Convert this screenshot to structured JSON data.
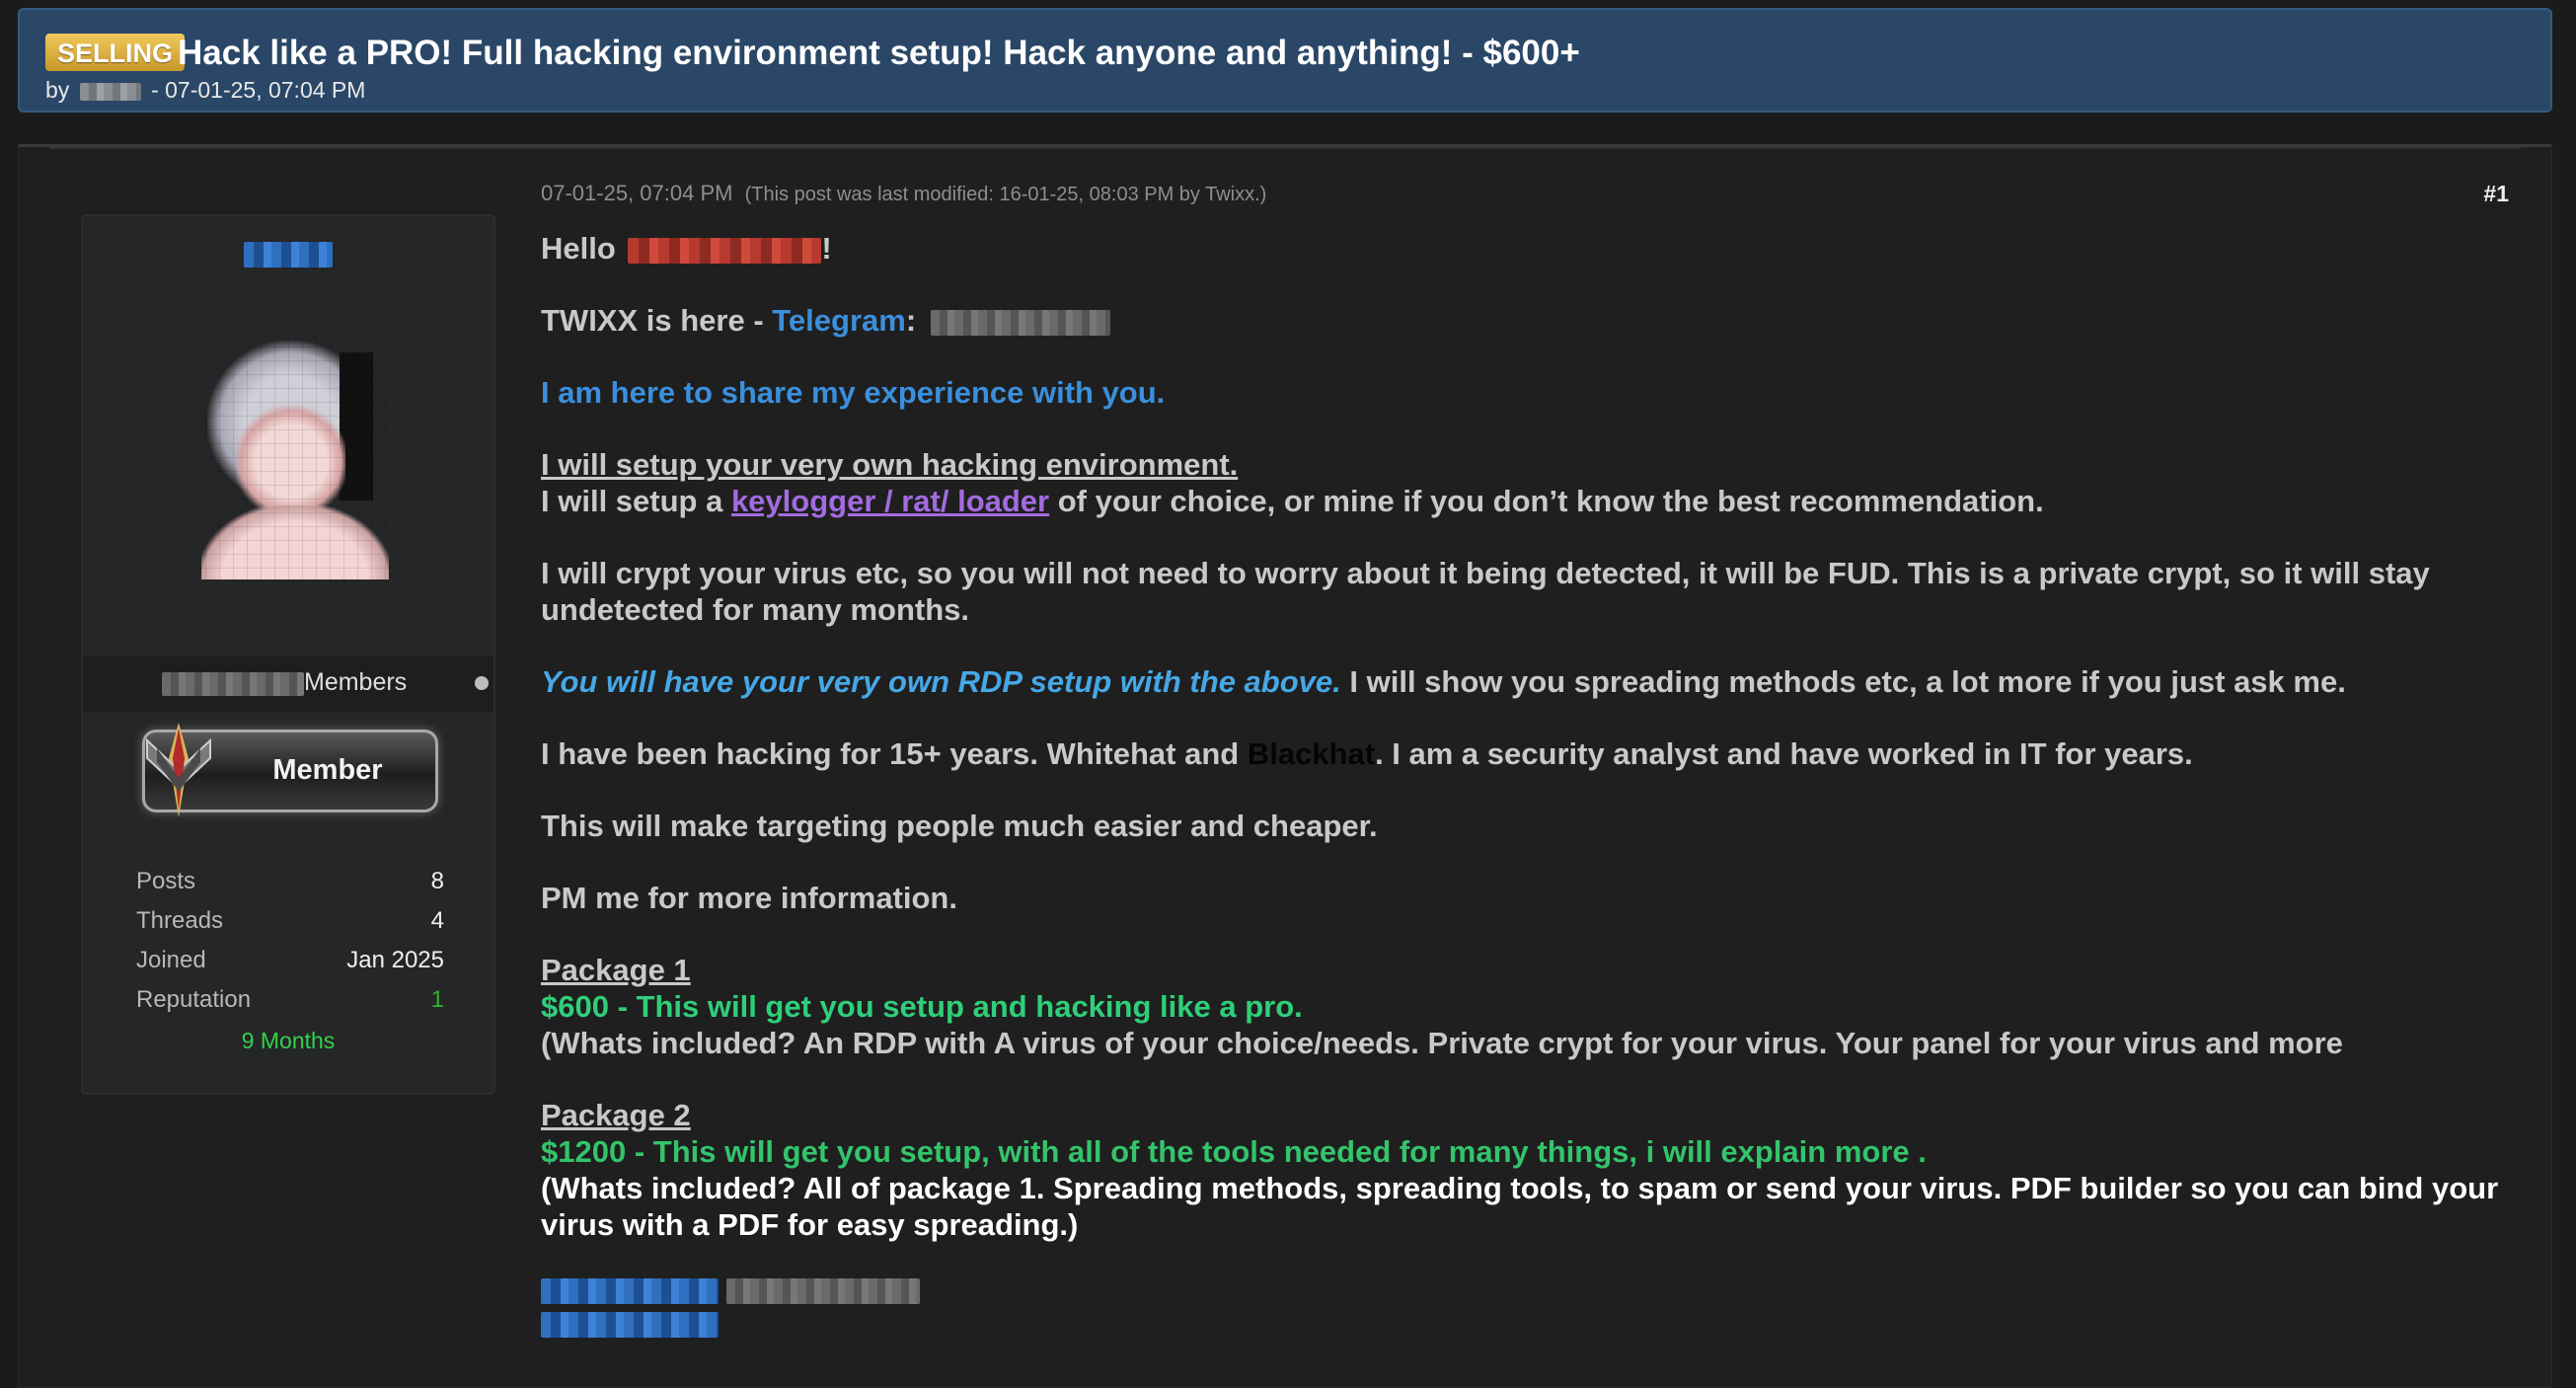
{
  "thread": {
    "prefix": "SELLING",
    "title": "Hack like a PRO! Full hacking environment setup! Hack anyone and anything! - $600+",
    "by_label": "by",
    "date_label": "- 07-01-25, 07:04 PM"
  },
  "author": {
    "group_suffix": "Members",
    "badge_label": "Member",
    "stats": [
      {
        "label": "Posts",
        "value": "8"
      },
      {
        "label": "Threads",
        "value": "4"
      },
      {
        "label": "Joined",
        "value": "Jan 2025"
      },
      {
        "label": "Reputation",
        "value": "1"
      }
    ],
    "tenure": "9 Months"
  },
  "post": {
    "date": "07-01-25, 07:04 PM",
    "modified_note": "(This post was last modified: 16-01-25, 08:03 PM by Twixx.)",
    "number": "#1",
    "greeting_prefix": "Hello",
    "greeting_suffix": "!",
    "intro_prefix": "TWIXX is here - ",
    "intro_link": "Telegram",
    "intro_colon": ":",
    "share_line": "I am here to share my experience with you.",
    "setup_heading": "I will setup your very own hacking environment.",
    "setup_prefix": "I will setup a ",
    "setup_link": "keylogger / rat/ loader",
    "setup_suffix": " of your choice, or mine if you don’t know the best recommendation.",
    "crypt_paragraph": "I will crypt your virus etc, so you will not need to worry about it being detected, it will be FUD. This is a private crypt, so it will stay undetected for many months.",
    "rdp_italic": "You will have your very own RDP setup with the above.",
    "rdp_suffix": " I will show you spreading methods etc, a lot more if you just ask me.",
    "exp_prefix": "I have been hacking for 15+ years. Whitehat and ",
    "exp_black": "Blackhat",
    "exp_suffix": ". I am a security analyst and have worked in IT for years.",
    "targeting_line": "This will make targeting people much easier and cheaper.",
    "pm_line": "PM me for more information.",
    "package1_heading": "Package 1",
    "package1_price": "$600 - This will get you setup and hacking like a pro.",
    "package1_desc": "(Whats included? An RDP with A virus of your choice/needs. Private crypt for your virus. Your panel for your virus and more",
    "package2_heading": "Package 2",
    "package2_price": "$1200 - This will get you setup, with all of the tools needed for many things, i will explain more .",
    "package2_desc": "(Whats included? All of package 1. Spreading methods, spreading tools, to spam or send your virus. PDF builder so you can bind your virus with a PDF for easy spreading.)"
  },
  "colors": {
    "header_bg": "#2a4767",
    "prefix_bg": "#e0b040",
    "link_blue": "#3b8fdc",
    "link_purple": "#a26be0",
    "price_green": "#2fcf7a",
    "tenure_green": "#32d24c"
  }
}
